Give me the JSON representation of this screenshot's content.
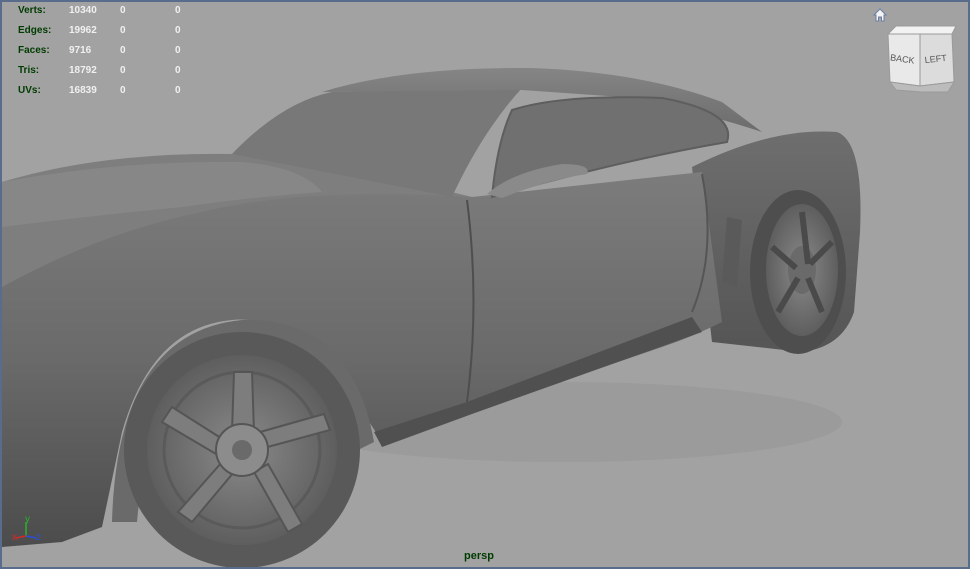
{
  "hud": {
    "rows": [
      {
        "label": "Verts:",
        "v1": "10340",
        "v2": "0",
        "v3": "0"
      },
      {
        "label": "Edges:",
        "v1": "19962",
        "v2": "0",
        "v3": "0"
      },
      {
        "label": "Faces:",
        "v1": "9716",
        "v2": "0",
        "v3": "0"
      },
      {
        "label": "Tris:",
        "v1": "18792",
        "v2": "0",
        "v3": "0"
      },
      {
        "label": "UVs:",
        "v1": "16839",
        "v2": "0",
        "v3": "0"
      }
    ]
  },
  "view_cube": {
    "face_back": "BACK",
    "face_left": "LEFT"
  },
  "axis": {
    "x": "x",
    "y": "y",
    "z": "z"
  },
  "camera_label": "persp",
  "colors": {
    "background": "#a2a2a2",
    "border": "#5a6c8c",
    "label_green": "#003b00",
    "axis_x": "#d22a2a",
    "axis_y": "#27b327",
    "axis_z": "#2b4fd6"
  }
}
